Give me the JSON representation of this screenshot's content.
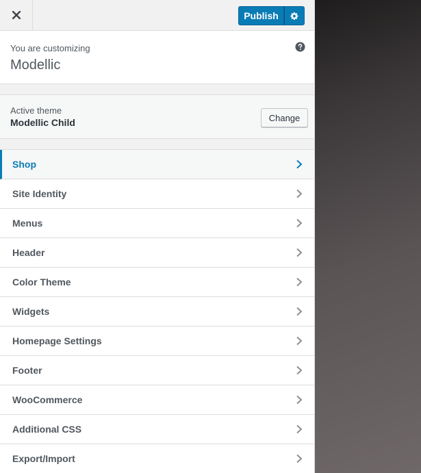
{
  "header": {
    "publish_label": "Publish"
  },
  "info": {
    "customizing_label": "You are customizing",
    "site_name": "Modellic"
  },
  "theme": {
    "label": "Active theme",
    "name": "Modellic Child",
    "change_label": "Change"
  },
  "menu": [
    {
      "label": "Shop",
      "active": true
    },
    {
      "label": "Site Identity"
    },
    {
      "label": "Menus"
    },
    {
      "label": "Header"
    },
    {
      "label": "Color Theme"
    },
    {
      "label": "Widgets"
    },
    {
      "label": "Homepage Settings"
    },
    {
      "label": "Footer"
    },
    {
      "label": "WooCommerce"
    },
    {
      "label": "Additional CSS"
    },
    {
      "label": "Export/Import"
    }
  ],
  "colors": {
    "accent": "#0a7cb5",
    "text": "#50575e"
  }
}
